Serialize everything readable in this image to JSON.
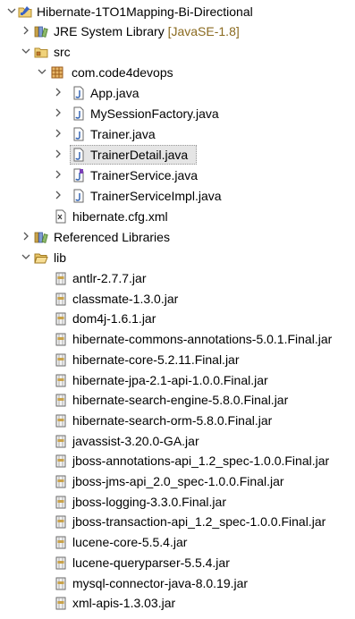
{
  "project": {
    "name": "Hibernate-1TO1Mapping-Bi-Directional"
  },
  "jre": {
    "name": "JRE System Library",
    "decoration": "[JavaSE-1.8]"
  },
  "src": {
    "name": "src"
  },
  "package": {
    "name": "com.code4devops"
  },
  "files": [
    {
      "name": "App.java"
    },
    {
      "name": "MySessionFactory.java"
    },
    {
      "name": "Trainer.java"
    },
    {
      "name": "TrainerDetail.java"
    },
    {
      "name": "TrainerService.java"
    },
    {
      "name": "TrainerServiceImpl.java"
    }
  ],
  "config": {
    "name": "hibernate.cfg.xml"
  },
  "referenced": {
    "name": "Referenced Libraries"
  },
  "lib": {
    "name": "lib"
  },
  "jars": [
    "antlr-2.7.7.jar",
    "classmate-1.3.0.jar",
    "dom4j-1.6.1.jar",
    "hibernate-commons-annotations-5.0.1.Final.jar",
    "hibernate-core-5.2.11.Final.jar",
    "hibernate-jpa-2.1-api-1.0.0.Final.jar",
    "hibernate-search-engine-5.8.0.Final.jar",
    "hibernate-search-orm-5.8.0.Final.jar",
    "javassist-3.20.0-GA.jar",
    "jboss-annotations-api_1.2_spec-1.0.0.Final.jar",
    "jboss-jms-api_2.0_spec-1.0.0.Final.jar",
    "jboss-logging-3.3.0.Final.jar",
    "jboss-transaction-api_1.2_spec-1.0.0.Final.jar",
    "lucene-core-5.5.4.jar",
    "lucene-queryparser-5.5.4.jar",
    "mysql-connector-java-8.0.19.jar",
    "xml-apis-1.3.03.jar"
  ]
}
